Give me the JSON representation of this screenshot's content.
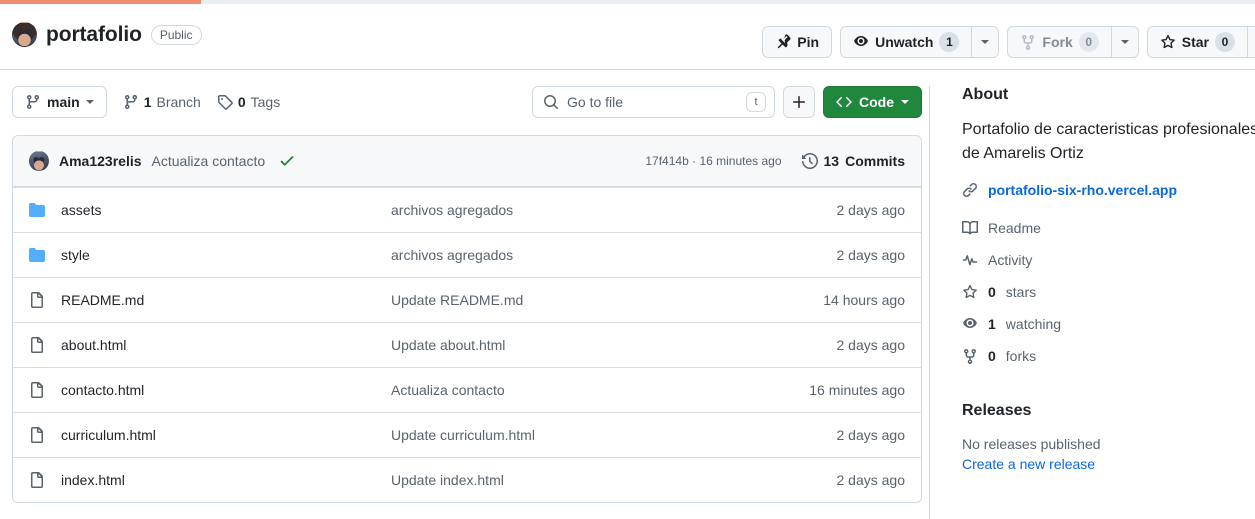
{
  "progress": {
    "percent": 16
  },
  "repo": {
    "owner_avatar": "owner-avatar",
    "name": "portafolio",
    "visibility": "Public"
  },
  "header_actions": {
    "pin": {
      "label": "Pin",
      "icon": "pin-icon"
    },
    "watch": {
      "label": "Unwatch",
      "count": "1",
      "icon": "eye-icon"
    },
    "fork": {
      "label": "Fork",
      "count": "0",
      "icon": "fork-icon",
      "disabled": true
    },
    "star": {
      "label": "Star",
      "count": "0",
      "icon": "star-icon"
    }
  },
  "toolbar": {
    "branch": {
      "name": "main",
      "icon": "branch-icon"
    },
    "branches": {
      "count": "1",
      "label": "Branch",
      "icon": "branch-icon"
    },
    "tags": {
      "count": "0",
      "label": "Tags",
      "icon": "tag-icon"
    },
    "search": {
      "placeholder": "Go to file",
      "kbd": "t",
      "icon": "search-icon"
    },
    "add_file": {
      "label": "+",
      "icon": "plus-icon"
    },
    "code": {
      "label": "Code",
      "icon": "code-icon"
    }
  },
  "latest_commit": {
    "author": "Ama123relis",
    "message": "Actualiza contacto",
    "status_icon": "check-icon",
    "sha": "17f414b",
    "separator": "·",
    "age": "16 minutes ago",
    "commits_count": "13",
    "commits_label": "Commits",
    "history_icon": "history-icon"
  },
  "files": [
    {
      "type": "dir",
      "icon": "folder-icon",
      "name": "assets",
      "commit": "archivos agregados",
      "age": "2 days ago"
    },
    {
      "type": "dir",
      "icon": "folder-icon",
      "name": "style",
      "commit": "archivos agregados",
      "age": "2 days ago"
    },
    {
      "type": "file",
      "icon": "file-icon",
      "name": "README.md",
      "commit": "Update README.md",
      "age": "14 hours ago"
    },
    {
      "type": "file",
      "icon": "file-icon",
      "name": "about.html",
      "commit": "Update about.html",
      "age": "2 days ago"
    },
    {
      "type": "file",
      "icon": "file-icon",
      "name": "contacto.html",
      "commit": "Actualiza contacto",
      "age": "16 minutes ago"
    },
    {
      "type": "file",
      "icon": "file-icon",
      "name": "curriculum.html",
      "commit": "Update curriculum.html",
      "age": "2 days ago"
    },
    {
      "type": "file",
      "icon": "file-icon",
      "name": "index.html",
      "commit": "Update index.html",
      "age": "2 days ago"
    }
  ],
  "about": {
    "title": "About",
    "description_line1": "Portafolio de caracteristicas profesionales",
    "description_line2": "de Amarelis Ortiz",
    "homepage": "portafolio-six-rho.vercel.app",
    "homepage_icon": "link-icon",
    "links": [
      {
        "icon": "book-icon",
        "label": "Readme",
        "count": ""
      },
      {
        "icon": "activity-icon",
        "label": "Activity",
        "count": ""
      },
      {
        "icon": "star-icon",
        "label": "stars",
        "count": "0"
      },
      {
        "icon": "eye-icon",
        "label": "watching",
        "count": "1"
      },
      {
        "icon": "fork-icon",
        "label": "forks",
        "count": "0"
      }
    ]
  },
  "releases": {
    "title": "Releases",
    "empty_text": "No releases published",
    "create_link": "Create a new release"
  },
  "colors": {
    "accent": "#0969da",
    "green": "#1f883d",
    "folder_blue": "#54aeff",
    "progress": "#f08d72",
    "border": "#d1d9e0",
    "muted": "#59636e"
  }
}
